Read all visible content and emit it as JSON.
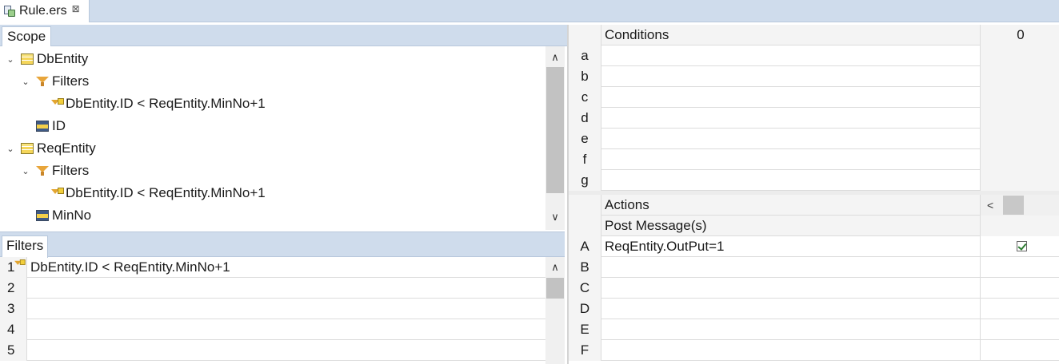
{
  "editor_tab": {
    "title": "Rule.ers",
    "close": "⊠"
  },
  "scope": {
    "tab_label": "Scope",
    "tree": [
      {
        "label": "DbEntity",
        "chevron": "⌄",
        "icon": "entity-icon"
      },
      {
        "label": "Filters",
        "chevron": "⌄",
        "icon": "filter-funnel-icon"
      },
      {
        "label": "DbEntity.ID < ReqEntity.MinNo+1",
        "icon": "filter-reference-icon"
      },
      {
        "label": "ID",
        "icon": "attribute-icon"
      },
      {
        "label": "ReqEntity",
        "chevron": "⌄",
        "icon": "entity-icon"
      },
      {
        "label": "Filters",
        "chevron": "⌄",
        "icon": "filter-funnel-icon"
      },
      {
        "label": "DbEntity.ID < ReqEntity.MinNo+1",
        "icon": "filter-reference-icon"
      },
      {
        "label": "MinNo",
        "icon": "attribute-icon"
      }
    ],
    "scroll_up": "∧",
    "scroll_down": "∨"
  },
  "filters": {
    "tab_label": "Filters",
    "rows": [
      {
        "num": "1",
        "text": "DbEntity.ID < ReqEntity.MinNo+1"
      },
      {
        "num": "2",
        "text": ""
      },
      {
        "num": "3",
        "text": ""
      },
      {
        "num": "4",
        "text": ""
      },
      {
        "num": "5",
        "text": ""
      }
    ],
    "scroll_up": "∧"
  },
  "decision_table": {
    "conditions_header": "Conditions",
    "conditions_count": "0",
    "condition_rows": [
      "a",
      "b",
      "c",
      "d",
      "e",
      "f",
      "g"
    ],
    "actions_header": "Actions",
    "scroll_left": "<",
    "post_messages_label": "Post Message(s)",
    "action_rows": [
      {
        "label": "A",
        "text": "ReqEntity.OutPut=1",
        "checked": true
      },
      {
        "label": "B",
        "text": ""
      },
      {
        "label": "C",
        "text": ""
      },
      {
        "label": "D",
        "text": ""
      },
      {
        "label": "E",
        "text": ""
      },
      {
        "label": "F",
        "text": ""
      }
    ]
  },
  "colors": {
    "tab_bar": "#cfdcec",
    "grid_line": "#dcdcdc",
    "check": "#2e7d32"
  }
}
